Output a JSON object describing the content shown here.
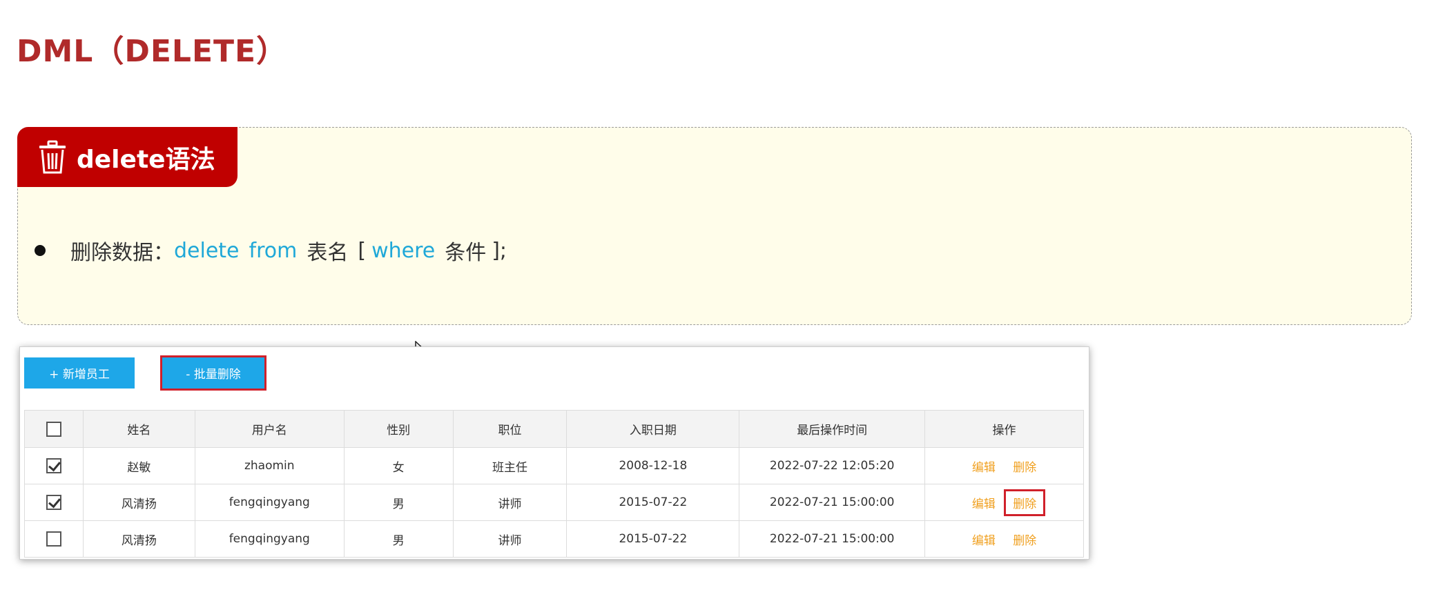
{
  "page": {
    "title": "DML（DELETE）"
  },
  "syntax": {
    "header": "delete语法",
    "icon": "trash-icon",
    "line": {
      "label": "删除数据：",
      "kw_delete": "delete",
      "kw_from": "from",
      "table": "表名",
      "bracket_open": "[",
      "kw_where": "where",
      "condition": "条件",
      "bracket_close": "];"
    }
  },
  "toolbar": {
    "add_label": "+ 新增员工",
    "batch_delete_label": "- 批量删除"
  },
  "table": {
    "headers": [
      "姓名",
      "用户名",
      "性别",
      "职位",
      "入职日期",
      "最后操作时间",
      "操作"
    ],
    "rows": [
      {
        "checked": true,
        "name": "赵敏",
        "username": "zhaomin",
        "gender": "女",
        "position": "班主任",
        "entry_date": "2008-12-18",
        "last_op": "2022-07-22 12:05:20",
        "edit": "编辑",
        "delete": "删除"
      },
      {
        "checked": true,
        "name": "风清扬",
        "username": "fengqingyang",
        "gender": "男",
        "position": "讲师",
        "entry_date": "2015-07-22",
        "last_op": "2022-07-21 15:00:00",
        "edit": "编辑",
        "delete": "删除"
      },
      {
        "checked": false,
        "name": "风清扬",
        "username": "fengqingyang",
        "gender": "男",
        "position": "讲师",
        "entry_date": "2015-07-22",
        "last_op": "2022-07-21 15:00:00",
        "edit": "编辑",
        "delete": "删除"
      }
    ]
  },
  "colors": {
    "title": "#b02a2a",
    "header_bg": "#c00000",
    "keyword": "#1fa8d8",
    "button": "#1ea7e8",
    "highlight": "#d0202a",
    "action": "#f0a020"
  }
}
